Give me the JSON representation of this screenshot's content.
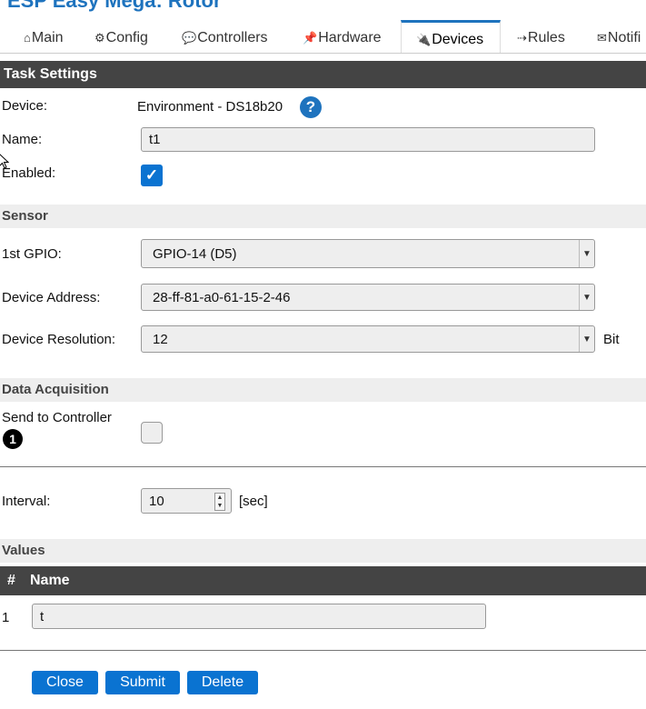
{
  "app": {
    "title": "ESP Easy Mega: Rotor"
  },
  "tabs": [
    {
      "icon": "⌂",
      "label": "Main"
    },
    {
      "icon": "⚙",
      "label": "Config"
    },
    {
      "icon": "💬",
      "label": "Controllers"
    },
    {
      "icon": "📌",
      "label": "Hardware"
    },
    {
      "icon": "🔌",
      "label": "Devices"
    },
    {
      "icon": "⇢",
      "label": "Rules"
    },
    {
      "icon": "✉",
      "label": "Notifi"
    }
  ],
  "task_settings": {
    "header": "Task Settings",
    "device_label": "Device:",
    "device_value": "Environment - DS18b20",
    "help_glyph": "?",
    "name_label": "Name:",
    "name_value": "t1",
    "enabled_label": "Enabled:",
    "enabled_checked": true
  },
  "sensor": {
    "header": "Sensor",
    "gpio_label": "1st GPIO:",
    "gpio_value": "GPIO-14 (D5)",
    "address_label": "Device Address:",
    "address_value": "28-ff-81-a0-61-15-2-46",
    "resolution_label": "Device Resolution:",
    "resolution_value": "12",
    "resolution_unit": "Bit"
  },
  "data_acquisition": {
    "header": "Data Acquisition",
    "send_label": "Send to Controller",
    "controller_number": "1",
    "send_checked": false,
    "interval_label": "Interval:",
    "interval_value": "10",
    "interval_unit": "[sec]"
  },
  "values": {
    "header": "Values",
    "col_num": "#",
    "col_name": "Name",
    "rows": [
      {
        "num": "1",
        "name": "t"
      }
    ]
  },
  "buttons": {
    "close": "Close",
    "submit": "Submit",
    "delete": "Delete"
  },
  "colors": {
    "accent": "#0a73d1",
    "header_dark": "#444444",
    "section_light": "#eeeeee"
  }
}
